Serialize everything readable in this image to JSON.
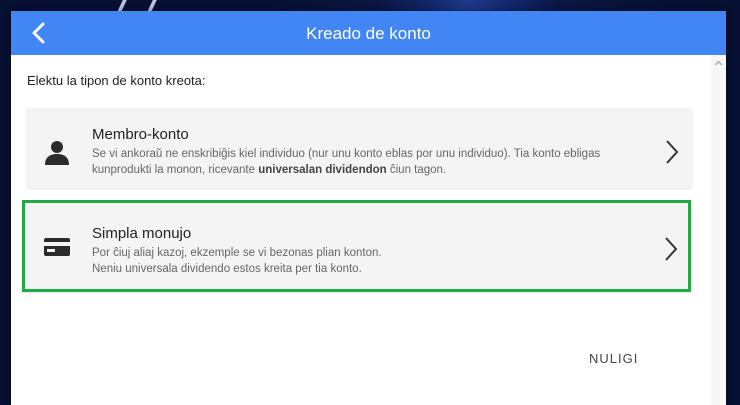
{
  "header": {
    "title": "Kreado de konto"
  },
  "prompt": "Elektu la tipon de konto kreota:",
  "options": [
    {
      "title": "Membro-konto",
      "desc_part1": "Se vi ankoraŭ ne enskribiĝis kiel individuo (nur unu konto eblas por unu individuo). Tia konto ebligas kunprodukti la monon, ricevante ",
      "desc_bold": "universalan dividendon",
      "desc_part2": " ĉiun tagon.",
      "icon": "person-icon"
    },
    {
      "title": "Simpla monujo",
      "desc_line1": "Por ĉiuj aliaj kazoj, ekzemple se vi bezonas plian konton.",
      "desc_line2": "Neniu universala dividendo estos kreita per tia konto.",
      "icon": "credit-card-icon",
      "highlight_color": "#22a845"
    }
  ],
  "cancel_label": "NULIGI",
  "colors": {
    "header": "#4285f4",
    "card_background": "#f4f4f4",
    "highlight": "#22a845"
  }
}
